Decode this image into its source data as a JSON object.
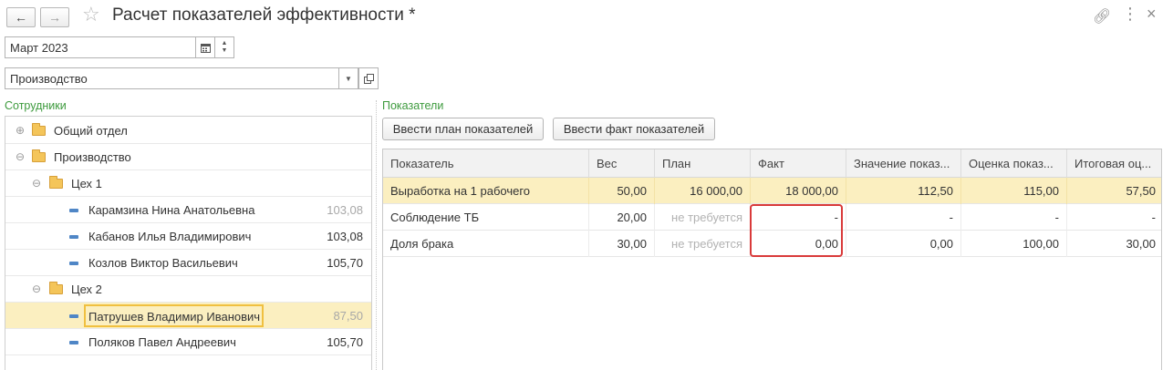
{
  "header": {
    "title": "Расчет показателей эффективности *",
    "back_icon": "arrow-left-icon",
    "forward_icon": "arrow-right-icon",
    "favorite_icon": "star-icon",
    "link_icon": "link-icon",
    "menu_icon": "more-icon",
    "close_icon": "close-icon"
  },
  "filters": {
    "period_value": "Март 2023",
    "department_value": "Производство"
  },
  "employees": {
    "title": "Сотрудники",
    "items": [
      {
        "label": "Общий отдел",
        "type": "folder",
        "expander": "⊕",
        "value": ""
      },
      {
        "label": "Производство",
        "type": "folder",
        "expander": "⊖",
        "value": ""
      },
      {
        "label": "Цех 1",
        "type": "folder",
        "expander": "⊖",
        "value": ""
      },
      {
        "label": "Карамзина Нина Анатольевна",
        "type": "employee",
        "value": "103,08"
      },
      {
        "label": "Кабанов Илья Владимирович",
        "type": "employee",
        "value": "103,08"
      },
      {
        "label": "Козлов Виктор Васильевич",
        "type": "employee",
        "value": "105,70"
      },
      {
        "label": "Цех 2",
        "type": "folder",
        "expander": "⊖",
        "value": ""
      },
      {
        "label": "Патрушев Владимир Иванович",
        "type": "employee",
        "value": "87,50"
      },
      {
        "label": "Поляков Павел Андреевич",
        "type": "employee",
        "value": "105,70"
      }
    ]
  },
  "indicators": {
    "title": "Показатели",
    "buttons": {
      "enter_plan": "Ввести план показателей",
      "enter_fact": "Ввести факт показателей"
    },
    "columns": [
      "Показатель",
      "Вес",
      "План",
      "Факт",
      "Значение показ...",
      "Оценка показ...",
      "Итоговая оц..."
    ],
    "rows": [
      {
        "name": "Выработка на 1 рабочего",
        "weight": "50,00",
        "plan": "16 000,00",
        "fact": "18 000,00",
        "value": "112,50",
        "score": "115,00",
        "total": "57,50"
      },
      {
        "name": "Соблюдение ТБ",
        "weight": "20,00",
        "plan": "не требуется",
        "fact": "-",
        "value": "-",
        "score": "-",
        "total": "-"
      },
      {
        "name": "Доля брака",
        "weight": "30,00",
        "plan": "не требуется",
        "fact": "0,00",
        "value": "0,00",
        "score": "100,00",
        "total": "30,00"
      }
    ]
  },
  "colors": {
    "group_title": "#3d9a3d",
    "selection": "#fbefc0",
    "highlight_box": "#d93a3a",
    "folder": "#f4c55a",
    "employee_marker": "#4f86c6"
  }
}
